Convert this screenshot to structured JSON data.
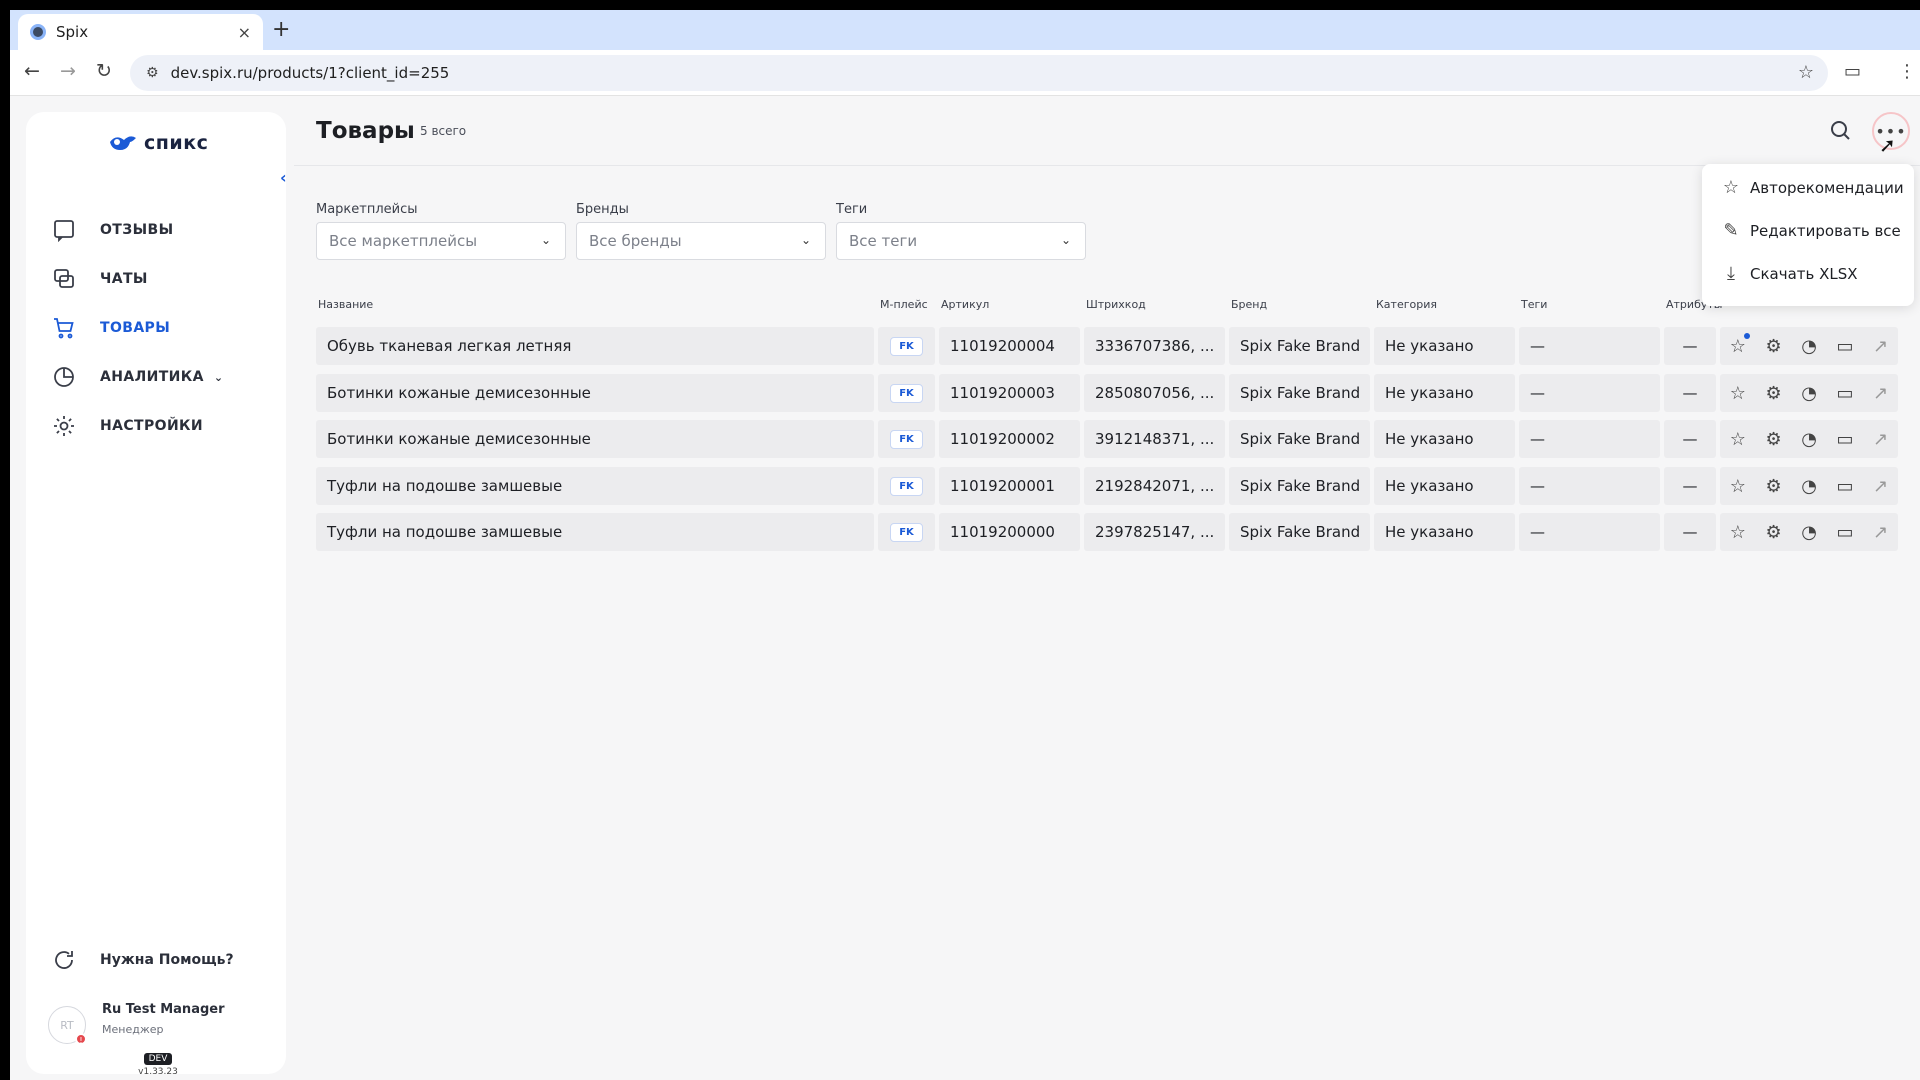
{
  "browser": {
    "tab_title": "Spix",
    "tab_close": "×",
    "new_tab": "+",
    "url": "dev.spix.ru/products/1?client_id=255"
  },
  "sidebar": {
    "logo_text": "спикс",
    "items": [
      {
        "label": "ОТЗЫВЫ",
        "icon": "message-square-icon"
      },
      {
        "label": "ЧАТЫ",
        "icon": "chats-icon"
      },
      {
        "label": "ТОВАРЫ",
        "icon": "cart-icon",
        "active": true
      },
      {
        "label": "АНАЛИТИКА",
        "icon": "pie-chart-icon"
      },
      {
        "label": "НАСТРОЙКИ",
        "icon": "gear-icon"
      }
    ],
    "help_label": "Нужна Помощь?",
    "user": {
      "initials": "RT",
      "name": "Ru Test Manager",
      "role": "Менеджер"
    },
    "env_badge": "DEV",
    "version": "v1.33.23"
  },
  "header": {
    "title": "Товары",
    "count": "5 всего"
  },
  "filters": [
    {
      "label": "Маркетплейсы",
      "value": "Все маркетплейсы"
    },
    {
      "label": "Бренды",
      "value": "Все бренды"
    },
    {
      "label": "Теги",
      "value": "Все теги"
    }
  ],
  "table": {
    "columns": [
      "Название",
      "М-плейс",
      "Артикул",
      "Штрихкод",
      "Бренд",
      "Категория",
      "Теги",
      "Атрибуты"
    ],
    "rows": [
      {
        "name": "Обувь тканевая легкая летняя",
        "marketplace": "FK",
        "article": "11019200004",
        "barcode": "3336707386, ...",
        "brand": "Spix Fake Brand",
        "category": "Не указано",
        "tags": "—",
        "attrs": "—"
      },
      {
        "name": "Ботинки кожаные демисезонные",
        "marketplace": "FK",
        "article": "11019200003",
        "barcode": "2850807056, ...",
        "brand": "Spix Fake Brand",
        "category": "Не указано",
        "tags": "—",
        "attrs": "—"
      },
      {
        "name": "Ботинки кожаные демисезонные",
        "marketplace": "FK",
        "article": "11019200002",
        "barcode": "3912148371, ...",
        "brand": "Spix Fake Brand",
        "category": "Не указано",
        "tags": "—",
        "attrs": "—"
      },
      {
        "name": "Туфли на подошве замшевые",
        "marketplace": "FK",
        "article": "11019200001",
        "barcode": "2192842071, ...",
        "brand": "Spix Fake Brand",
        "category": "Не указано",
        "tags": "—",
        "attrs": "—"
      },
      {
        "name": "Туфли на подошве замшевые",
        "marketplace": "FK",
        "article": "11019200000",
        "barcode": "2397825147, ...",
        "brand": "Spix Fake Brand",
        "category": "Не указано",
        "tags": "—",
        "attrs": "—"
      }
    ]
  },
  "menu": {
    "items": [
      {
        "label": "Авторекомендации",
        "icon": "star-icon"
      },
      {
        "label": "Редактировать все",
        "icon": "pencil-icon"
      },
      {
        "label": "Скачать XLSX",
        "icon": "download-icon"
      }
    ]
  },
  "colors": {
    "accent": "#1b5ad6",
    "active_nav": "#1b5ad6"
  }
}
